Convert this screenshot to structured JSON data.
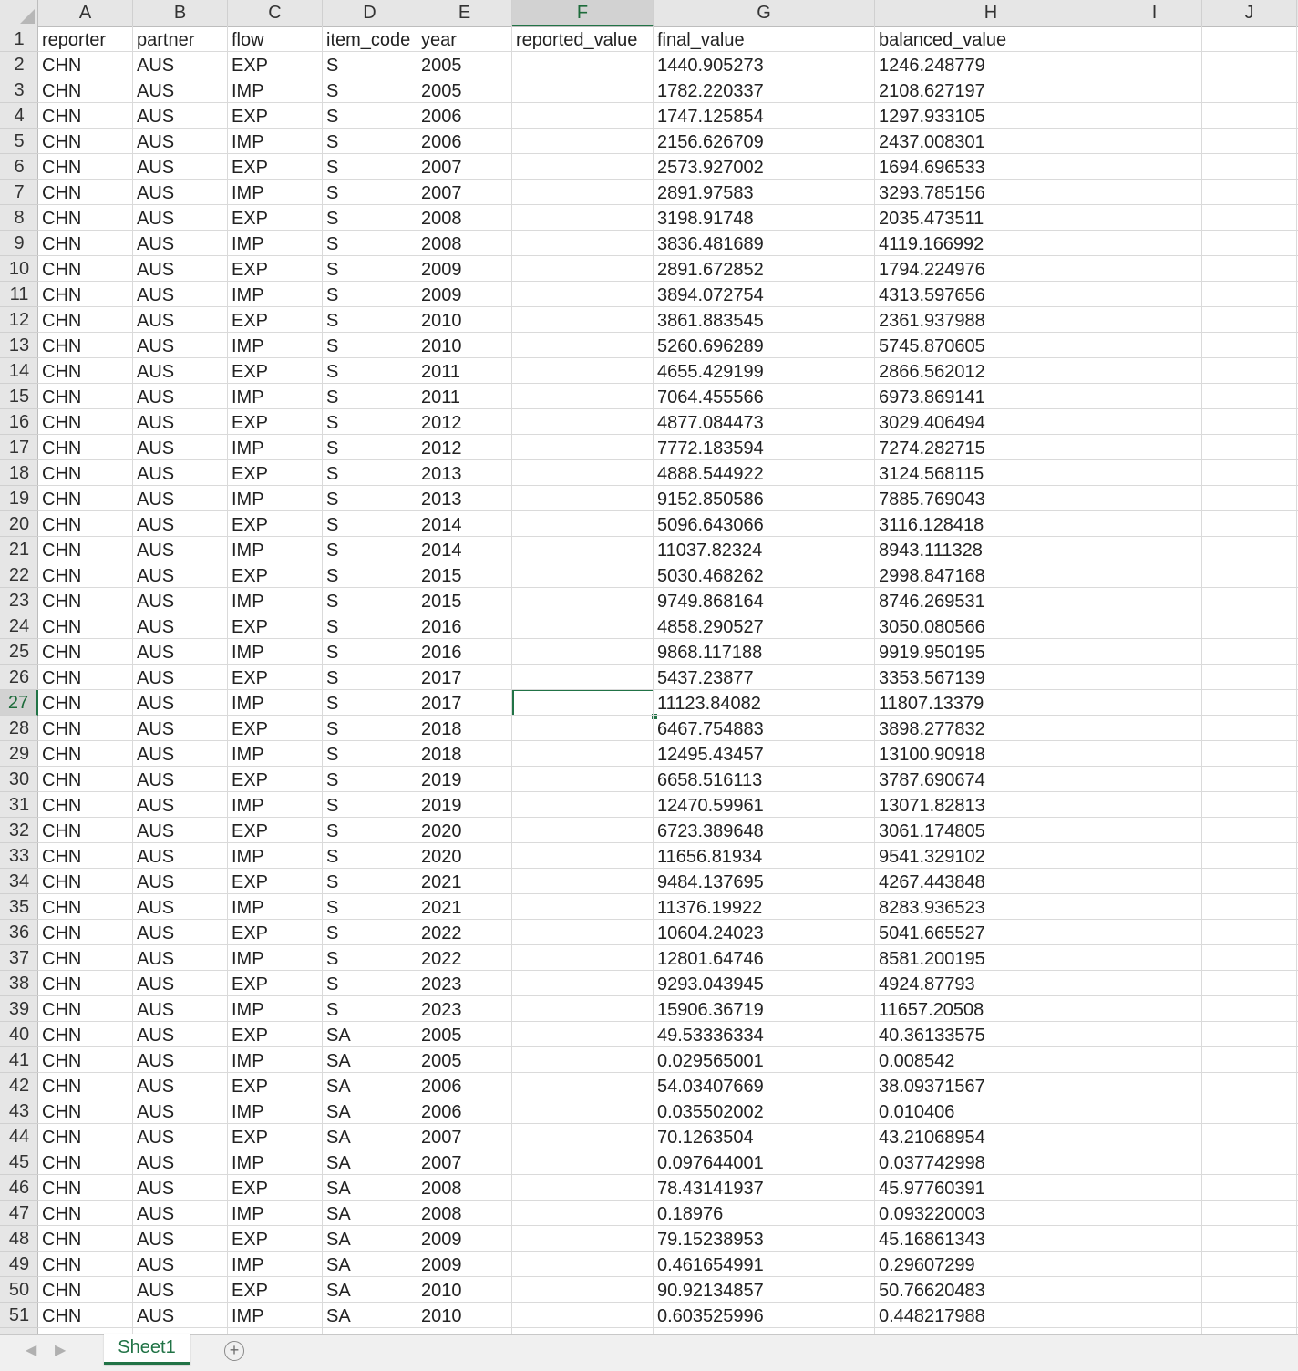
{
  "columns": [
    "A",
    "B",
    "C",
    "D",
    "E",
    "F",
    "G",
    "H",
    "I",
    "J"
  ],
  "selected_column": "F",
  "selected_row": 27,
  "sheet_tab": "Sheet1",
  "rows": [
    [
      "reporter",
      "partner",
      "flow",
      "item_code",
      "year",
      "reported_value",
      "final_value",
      "balanced_value"
    ],
    [
      "CHN",
      "AUS",
      "EXP",
      "S",
      "2005",
      "",
      "1440.905273",
      "1246.248779"
    ],
    [
      "CHN",
      "AUS",
      "IMP",
      "S",
      "2005",
      "",
      "1782.220337",
      "2108.627197"
    ],
    [
      "CHN",
      "AUS",
      "EXP",
      "S",
      "2006",
      "",
      "1747.125854",
      "1297.933105"
    ],
    [
      "CHN",
      "AUS",
      "IMP",
      "S",
      "2006",
      "",
      "2156.626709",
      "2437.008301"
    ],
    [
      "CHN",
      "AUS",
      "EXP",
      "S",
      "2007",
      "",
      "2573.927002",
      "1694.696533"
    ],
    [
      "CHN",
      "AUS",
      "IMP",
      "S",
      "2007",
      "",
      "2891.97583",
      "3293.785156"
    ],
    [
      "CHN",
      "AUS",
      "EXP",
      "S",
      "2008",
      "",
      "3198.91748",
      "2035.473511"
    ],
    [
      "CHN",
      "AUS",
      "IMP",
      "S",
      "2008",
      "",
      "3836.481689",
      "4119.166992"
    ],
    [
      "CHN",
      "AUS",
      "EXP",
      "S",
      "2009",
      "",
      "2891.672852",
      "1794.224976"
    ],
    [
      "CHN",
      "AUS",
      "IMP",
      "S",
      "2009",
      "",
      "3894.072754",
      "4313.597656"
    ],
    [
      "CHN",
      "AUS",
      "EXP",
      "S",
      "2010",
      "",
      "3861.883545",
      "2361.937988"
    ],
    [
      "CHN",
      "AUS",
      "IMP",
      "S",
      "2010",
      "",
      "5260.696289",
      "5745.870605"
    ],
    [
      "CHN",
      "AUS",
      "EXP",
      "S",
      "2011",
      "",
      "4655.429199",
      "2866.562012"
    ],
    [
      "CHN",
      "AUS",
      "IMP",
      "S",
      "2011",
      "",
      "7064.455566",
      "6973.869141"
    ],
    [
      "CHN",
      "AUS",
      "EXP",
      "S",
      "2012",
      "",
      "4877.084473",
      "3029.406494"
    ],
    [
      "CHN",
      "AUS",
      "IMP",
      "S",
      "2012",
      "",
      "7772.183594",
      "7274.282715"
    ],
    [
      "CHN",
      "AUS",
      "EXP",
      "S",
      "2013",
      "",
      "4888.544922",
      "3124.568115"
    ],
    [
      "CHN",
      "AUS",
      "IMP",
      "S",
      "2013",
      "",
      "9152.850586",
      "7885.769043"
    ],
    [
      "CHN",
      "AUS",
      "EXP",
      "S",
      "2014",
      "",
      "5096.643066",
      "3116.128418"
    ],
    [
      "CHN",
      "AUS",
      "IMP",
      "S",
      "2014",
      "",
      "11037.82324",
      "8943.111328"
    ],
    [
      "CHN",
      "AUS",
      "EXP",
      "S",
      "2015",
      "",
      "5030.468262",
      "2998.847168"
    ],
    [
      "CHN",
      "AUS",
      "IMP",
      "S",
      "2015",
      "",
      "9749.868164",
      "8746.269531"
    ],
    [
      "CHN",
      "AUS",
      "EXP",
      "S",
      "2016",
      "",
      "4858.290527",
      "3050.080566"
    ],
    [
      "CHN",
      "AUS",
      "IMP",
      "S",
      "2016",
      "",
      "9868.117188",
      "9919.950195"
    ],
    [
      "CHN",
      "AUS",
      "EXP",
      "S",
      "2017",
      "",
      "5437.23877",
      "3353.567139"
    ],
    [
      "CHN",
      "AUS",
      "IMP",
      "S",
      "2017",
      "",
      "11123.84082",
      "11807.13379"
    ],
    [
      "CHN",
      "AUS",
      "EXP",
      "S",
      "2018",
      "",
      "6467.754883",
      "3898.277832"
    ],
    [
      "CHN",
      "AUS",
      "IMP",
      "S",
      "2018",
      "",
      "12495.43457",
      "13100.90918"
    ],
    [
      "CHN",
      "AUS",
      "EXP",
      "S",
      "2019",
      "",
      "6658.516113",
      "3787.690674"
    ],
    [
      "CHN",
      "AUS",
      "IMP",
      "S",
      "2019",
      "",
      "12470.59961",
      "13071.82813"
    ],
    [
      "CHN",
      "AUS",
      "EXP",
      "S",
      "2020",
      "",
      "6723.389648",
      "3061.174805"
    ],
    [
      "CHN",
      "AUS",
      "IMP",
      "S",
      "2020",
      "",
      "11656.81934",
      "9541.329102"
    ],
    [
      "CHN",
      "AUS",
      "EXP",
      "S",
      "2021",
      "",
      "9484.137695",
      "4267.443848"
    ],
    [
      "CHN",
      "AUS",
      "IMP",
      "S",
      "2021",
      "",
      "11376.19922",
      "8283.936523"
    ],
    [
      "CHN",
      "AUS",
      "EXP",
      "S",
      "2022",
      "",
      "10604.24023",
      "5041.665527"
    ],
    [
      "CHN",
      "AUS",
      "IMP",
      "S",
      "2022",
      "",
      "12801.64746",
      "8581.200195"
    ],
    [
      "CHN",
      "AUS",
      "EXP",
      "S",
      "2023",
      "",
      "9293.043945",
      "4924.87793"
    ],
    [
      "CHN",
      "AUS",
      "IMP",
      "S",
      "2023",
      "",
      "15906.36719",
      "11657.20508"
    ],
    [
      "CHN",
      "AUS",
      "EXP",
      "SA",
      "2005",
      "",
      "49.53336334",
      "40.36133575"
    ],
    [
      "CHN",
      "AUS",
      "IMP",
      "SA",
      "2005",
      "",
      "0.029565001",
      "0.008542"
    ],
    [
      "CHN",
      "AUS",
      "EXP",
      "SA",
      "2006",
      "",
      "54.03407669",
      "38.09371567"
    ],
    [
      "CHN",
      "AUS",
      "IMP",
      "SA",
      "2006",
      "",
      "0.035502002",
      "0.010406"
    ],
    [
      "CHN",
      "AUS",
      "EXP",
      "SA",
      "2007",
      "",
      "70.1263504",
      "43.21068954"
    ],
    [
      "CHN",
      "AUS",
      "IMP",
      "SA",
      "2007",
      "",
      "0.097644001",
      "0.037742998"
    ],
    [
      "CHN",
      "AUS",
      "EXP",
      "SA",
      "2008",
      "",
      "78.43141937",
      "45.97760391"
    ],
    [
      "CHN",
      "AUS",
      "IMP",
      "SA",
      "2008",
      "",
      "0.18976",
      "0.093220003"
    ],
    [
      "CHN",
      "AUS",
      "EXP",
      "SA",
      "2009",
      "",
      "79.15238953",
      "45.16861343"
    ],
    [
      "CHN",
      "AUS",
      "IMP",
      "SA",
      "2009",
      "",
      "0.461654991",
      "0.29607299"
    ],
    [
      "CHN",
      "AUS",
      "EXP",
      "SA",
      "2010",
      "",
      "90.92134857",
      "50.76620483"
    ],
    [
      "CHN",
      "AUS",
      "IMP",
      "SA",
      "2010",
      "",
      "0.603525996",
      "0.448217988"
    ]
  ]
}
